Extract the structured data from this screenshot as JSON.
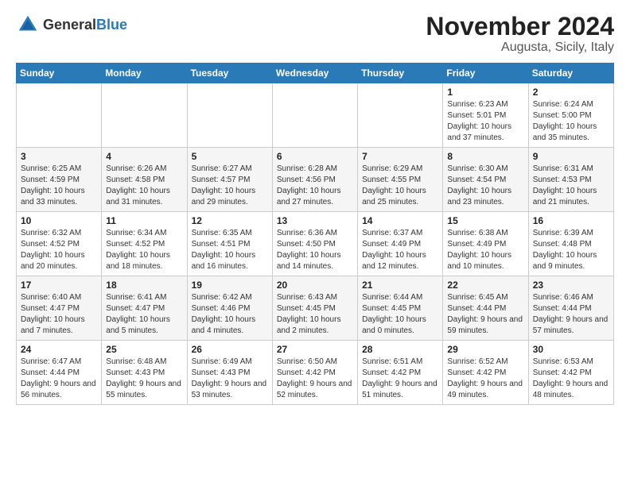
{
  "header": {
    "logo_general": "General",
    "logo_blue": "Blue",
    "month_title": "November 2024",
    "location": "Augusta, Sicily, Italy"
  },
  "weekdays": [
    "Sunday",
    "Monday",
    "Tuesday",
    "Wednesday",
    "Thursday",
    "Friday",
    "Saturday"
  ],
  "weeks": [
    [
      {
        "day": "",
        "info": ""
      },
      {
        "day": "",
        "info": ""
      },
      {
        "day": "",
        "info": ""
      },
      {
        "day": "",
        "info": ""
      },
      {
        "day": "",
        "info": ""
      },
      {
        "day": "1",
        "info": "Sunrise: 6:23 AM\nSunset: 5:01 PM\nDaylight: 10 hours and 37 minutes."
      },
      {
        "day": "2",
        "info": "Sunrise: 6:24 AM\nSunset: 5:00 PM\nDaylight: 10 hours and 35 minutes."
      }
    ],
    [
      {
        "day": "3",
        "info": "Sunrise: 6:25 AM\nSunset: 4:59 PM\nDaylight: 10 hours and 33 minutes."
      },
      {
        "day": "4",
        "info": "Sunrise: 6:26 AM\nSunset: 4:58 PM\nDaylight: 10 hours and 31 minutes."
      },
      {
        "day": "5",
        "info": "Sunrise: 6:27 AM\nSunset: 4:57 PM\nDaylight: 10 hours and 29 minutes."
      },
      {
        "day": "6",
        "info": "Sunrise: 6:28 AM\nSunset: 4:56 PM\nDaylight: 10 hours and 27 minutes."
      },
      {
        "day": "7",
        "info": "Sunrise: 6:29 AM\nSunset: 4:55 PM\nDaylight: 10 hours and 25 minutes."
      },
      {
        "day": "8",
        "info": "Sunrise: 6:30 AM\nSunset: 4:54 PM\nDaylight: 10 hours and 23 minutes."
      },
      {
        "day": "9",
        "info": "Sunrise: 6:31 AM\nSunset: 4:53 PM\nDaylight: 10 hours and 21 minutes."
      }
    ],
    [
      {
        "day": "10",
        "info": "Sunrise: 6:32 AM\nSunset: 4:52 PM\nDaylight: 10 hours and 20 minutes."
      },
      {
        "day": "11",
        "info": "Sunrise: 6:34 AM\nSunset: 4:52 PM\nDaylight: 10 hours and 18 minutes."
      },
      {
        "day": "12",
        "info": "Sunrise: 6:35 AM\nSunset: 4:51 PM\nDaylight: 10 hours and 16 minutes."
      },
      {
        "day": "13",
        "info": "Sunrise: 6:36 AM\nSunset: 4:50 PM\nDaylight: 10 hours and 14 minutes."
      },
      {
        "day": "14",
        "info": "Sunrise: 6:37 AM\nSunset: 4:49 PM\nDaylight: 10 hours and 12 minutes."
      },
      {
        "day": "15",
        "info": "Sunrise: 6:38 AM\nSunset: 4:49 PM\nDaylight: 10 hours and 10 minutes."
      },
      {
        "day": "16",
        "info": "Sunrise: 6:39 AM\nSunset: 4:48 PM\nDaylight: 10 hours and 9 minutes."
      }
    ],
    [
      {
        "day": "17",
        "info": "Sunrise: 6:40 AM\nSunset: 4:47 PM\nDaylight: 10 hours and 7 minutes."
      },
      {
        "day": "18",
        "info": "Sunrise: 6:41 AM\nSunset: 4:47 PM\nDaylight: 10 hours and 5 minutes."
      },
      {
        "day": "19",
        "info": "Sunrise: 6:42 AM\nSunset: 4:46 PM\nDaylight: 10 hours and 4 minutes."
      },
      {
        "day": "20",
        "info": "Sunrise: 6:43 AM\nSunset: 4:45 PM\nDaylight: 10 hours and 2 minutes."
      },
      {
        "day": "21",
        "info": "Sunrise: 6:44 AM\nSunset: 4:45 PM\nDaylight: 10 hours and 0 minutes."
      },
      {
        "day": "22",
        "info": "Sunrise: 6:45 AM\nSunset: 4:44 PM\nDaylight: 9 hours and 59 minutes."
      },
      {
        "day": "23",
        "info": "Sunrise: 6:46 AM\nSunset: 4:44 PM\nDaylight: 9 hours and 57 minutes."
      }
    ],
    [
      {
        "day": "24",
        "info": "Sunrise: 6:47 AM\nSunset: 4:44 PM\nDaylight: 9 hours and 56 minutes."
      },
      {
        "day": "25",
        "info": "Sunrise: 6:48 AM\nSunset: 4:43 PM\nDaylight: 9 hours and 55 minutes."
      },
      {
        "day": "26",
        "info": "Sunrise: 6:49 AM\nSunset: 4:43 PM\nDaylight: 9 hours and 53 minutes."
      },
      {
        "day": "27",
        "info": "Sunrise: 6:50 AM\nSunset: 4:42 PM\nDaylight: 9 hours and 52 minutes."
      },
      {
        "day": "28",
        "info": "Sunrise: 6:51 AM\nSunset: 4:42 PM\nDaylight: 9 hours and 51 minutes."
      },
      {
        "day": "29",
        "info": "Sunrise: 6:52 AM\nSunset: 4:42 PM\nDaylight: 9 hours and 49 minutes."
      },
      {
        "day": "30",
        "info": "Sunrise: 6:53 AM\nSunset: 4:42 PM\nDaylight: 9 hours and 48 minutes."
      }
    ]
  ]
}
